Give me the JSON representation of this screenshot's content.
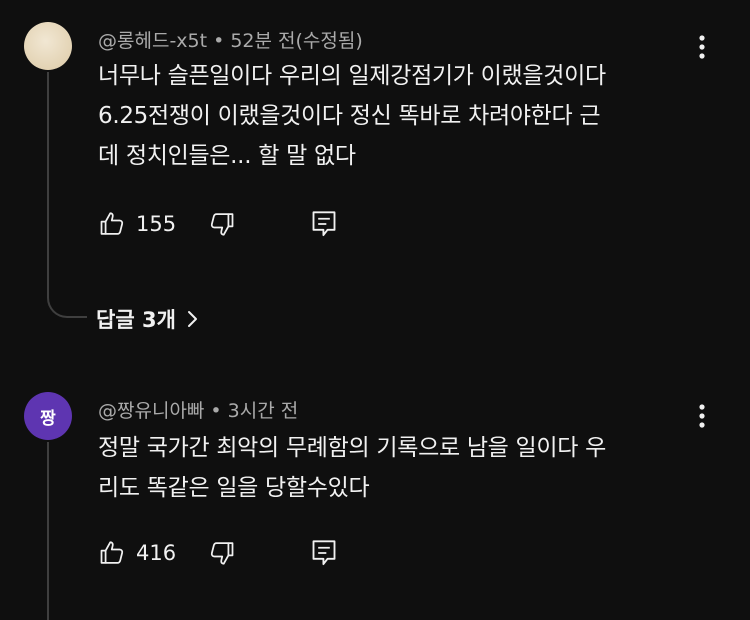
{
  "comments": [
    {
      "author": "@롱헤드-x5t",
      "time": "52분 전(수정됨)",
      "lines": [
        "너무나 슬픈일이다 우리의 일제강점기가 이랬을것이다",
        "6.25전쟁이 이랬을것이다 정신 똑바로 차려야한다 근",
        "데 정치인들은... 할 말 없다"
      ],
      "likes": "155",
      "avatar_color": "#e8dcc4"
    },
    {
      "author": "@짱유니아빠",
      "time": "3시간 전",
      "avatar_text": "짱",
      "avatar_color": "#5e35b1",
      "lines": [
        "정말 국가간 최악의  무례함의 기록으로 남을 일이다 우",
        "리도 똑같은 일을 당할수있다"
      ],
      "likes": "416"
    }
  ],
  "replies_toggle": "답글 3개",
  "separator": "•",
  "icons": {
    "more": "more-vert-icon",
    "like": "thumb-up-icon",
    "dislike": "thumb-down-icon",
    "reply": "reply-icon",
    "chevron": "chevron-right-icon"
  }
}
